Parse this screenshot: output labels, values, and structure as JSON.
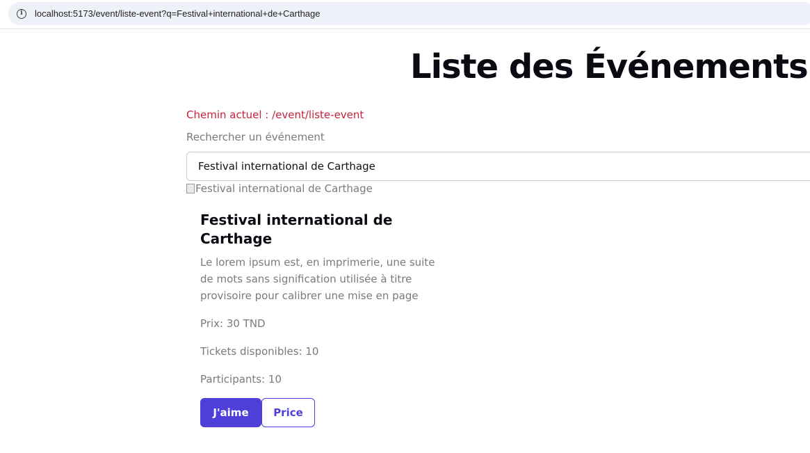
{
  "browser": {
    "url": "localhost:5173/event/liste-event?q=Festival+international+de+Carthage",
    "info_icon": "info-icon"
  },
  "page": {
    "title": "Liste des Événements",
    "current_path": "Chemin actuel : /event/liste-event",
    "search_label": "Rechercher un événement",
    "search_value": "Festival international de Carthage"
  },
  "event": {
    "image_alt": "Festival international de Carthage",
    "title": "Festival international de Carthage",
    "description": "Le lorem ipsum est, en imprimerie, une suite de mots sans signification utilisée à titre provisoire pour calibrer une mise en page",
    "price": "Prix: 30 TND",
    "tickets": "Tickets disponibles: 10",
    "participants": "Participants: 10",
    "like_label": "J'aime",
    "price_label": "Price"
  },
  "colors": {
    "accent": "#4f3fd9",
    "path_text": "#c8213b",
    "muted_text": "#7a7a7a"
  }
}
